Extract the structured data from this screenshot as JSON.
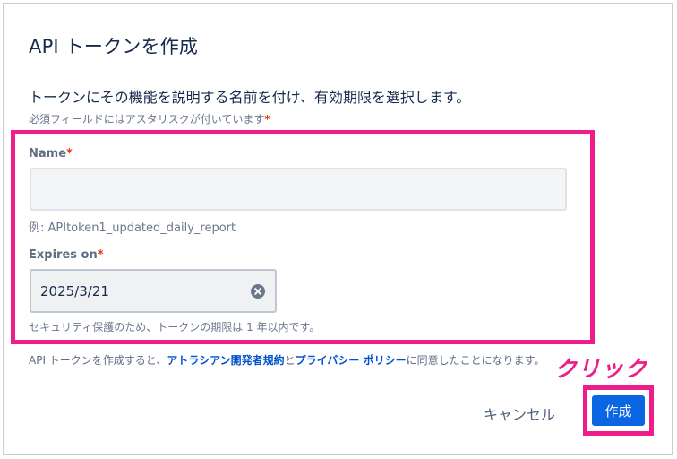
{
  "dialog": {
    "title": "API トークンを作成",
    "description": "トークンにその機能を説明する名前を付け、有効期限を選択します。",
    "required_note": "必須フィールドにはアスタリスクが付いています",
    "required_marker": "*"
  },
  "form": {
    "name_label": "Name",
    "name_value": "",
    "name_placeholder": "",
    "name_helper": "例: APItoken1_updated_daily_report",
    "expires_label": "Expires on",
    "expires_value": "2025/3/21",
    "expires_helper": "セキュリティ保護のため、トークンの期限は 1 年以内です。"
  },
  "terms": {
    "prefix": "API トークンを作成すると、",
    "link1": "アトラシアン開発者規約",
    "middle": "と",
    "link2": "プライバシー ポリシー",
    "suffix": "に同意したことになります。"
  },
  "annotation": {
    "click_label": "クリック"
  },
  "footer": {
    "cancel_label": "キャンセル",
    "create_label": "作成"
  },
  "colors": {
    "highlight": "#ee1d8a",
    "primary_button": "#0b66e4",
    "link": "#0052cc",
    "required": "#de350b"
  },
  "icons": {
    "clear_date": "clear-circle-icon"
  }
}
